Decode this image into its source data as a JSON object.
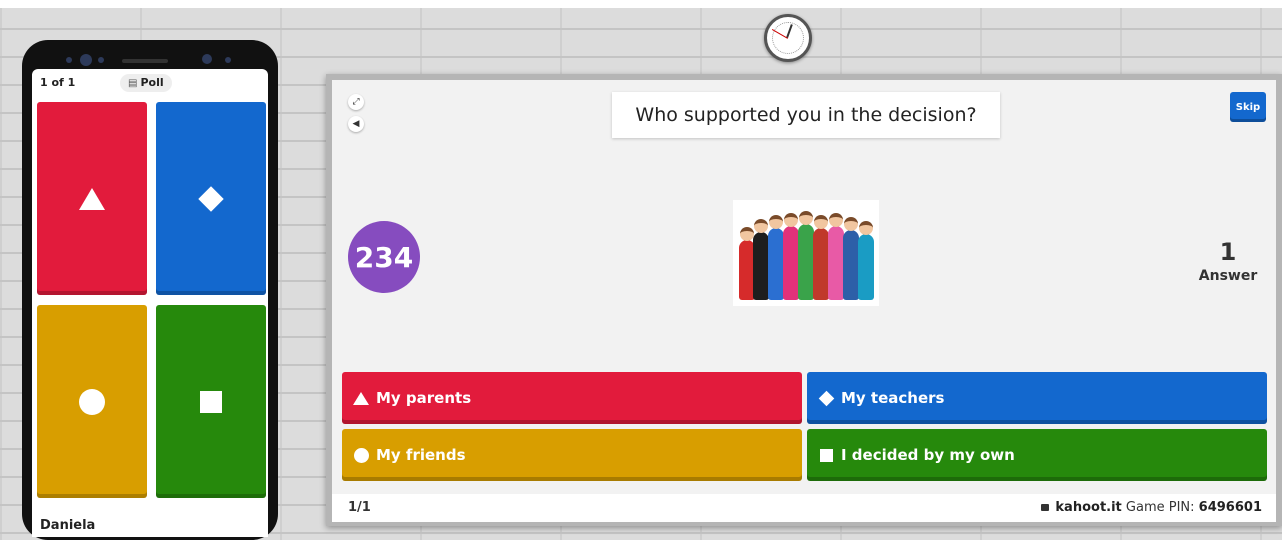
{
  "phone": {
    "counter": "1 of 1",
    "quiz_type_label": "Poll",
    "player_name": "Daniela",
    "tiles": [
      {
        "shape": "triangle-icon",
        "color": "#e21b3c"
      },
      {
        "shape": "diamond-icon",
        "color": "#1368ce"
      },
      {
        "shape": "circle-icon",
        "color": "#d89e00"
      },
      {
        "shape": "square-icon",
        "color": "#26890c"
      }
    ]
  },
  "host": {
    "question": "Who supported you in the decision?",
    "skip_label": "Skip",
    "timer": "234",
    "answers_count": "1",
    "answers_label": "Answer",
    "answers": [
      {
        "label": "My parents",
        "color": "#e21b3c",
        "shape": "triangle-icon"
      },
      {
        "label": "My teachers",
        "color": "#1368ce",
        "shape": "diamond-icon"
      },
      {
        "label": "My friends",
        "color": "#d89e00",
        "shape": "circle-icon"
      },
      {
        "label": "I decided by my own",
        "color": "#26890c",
        "shape": "square-icon"
      }
    ],
    "footer": {
      "question_count": "1/1",
      "site": "kahoot.it",
      "pin_label": "Game PIN:",
      "pin": "6496601"
    }
  }
}
